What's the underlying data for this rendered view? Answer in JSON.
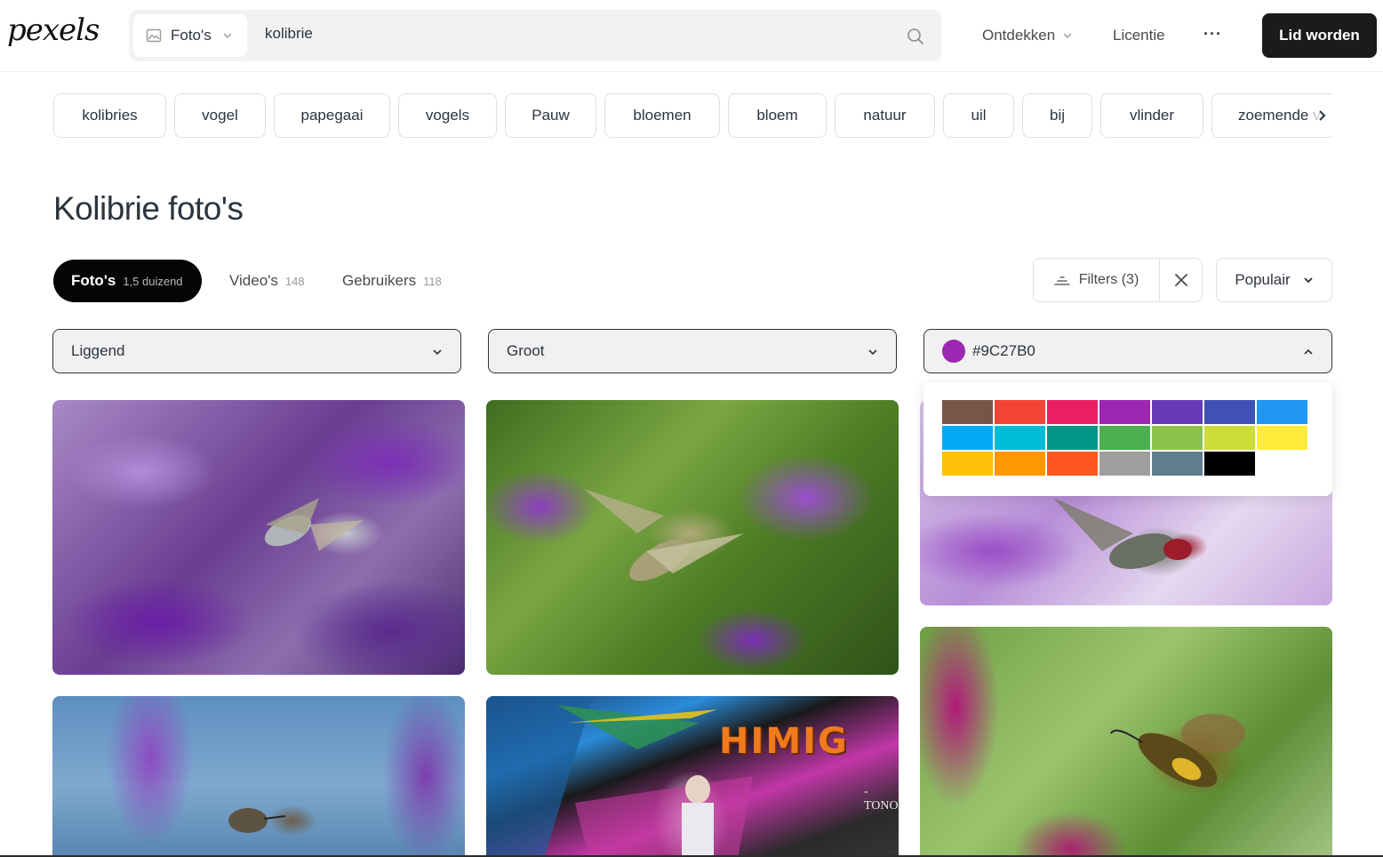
{
  "header": {
    "logo": "pexels",
    "search": {
      "type_label": "Foto's",
      "value": "kolibrie"
    },
    "nav": {
      "discover": "Ontdekken",
      "license": "Licentie",
      "more": "···"
    },
    "join_label": "Lid worden"
  },
  "related_searches": [
    "kolibries",
    "vogel",
    "papegaai",
    "vogels",
    "Pauw",
    "bloemen",
    "bloem",
    "natuur",
    "uil",
    "bij",
    "vlinder",
    "zoemende v"
  ],
  "page_title": "Kolibrie foto's",
  "tabs": [
    {
      "label": "Foto's",
      "count": "1,5 duizend",
      "active": true
    },
    {
      "label": "Video's",
      "count": "148",
      "active": false
    },
    {
      "label": "Gebruikers",
      "count": "118",
      "active": false
    }
  ],
  "filters": {
    "label": "Filters (3)",
    "sort_label": "Populair"
  },
  "filter_selects": {
    "orientation": "Liggend",
    "size": "Groot",
    "color": "#9C27B0"
  },
  "colors": {
    "accent_dark": "#050505",
    "selected_color": "#9C27B0"
  },
  "palette": [
    "#795548",
    "#F44336",
    "#E91E63",
    "#9C27B0",
    "#673AB7",
    "#3F51B5",
    "#2196F3",
    "#03A9F4",
    "#00BCD4",
    "#009688",
    "#4CAF50",
    "#8BC34A",
    "#CDDC39",
    "#FFEB3B",
    "#FFC107",
    "#FF9800",
    "#FF5722",
    "#9E9E9E",
    "#607D8B",
    "#000000"
  ],
  "photos": {
    "mural_text": "HIMIG",
    "mural_tag": "-TONO"
  }
}
